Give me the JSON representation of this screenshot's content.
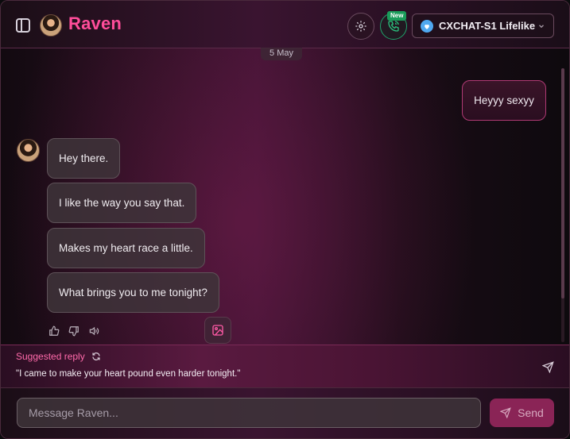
{
  "header": {
    "title": "Raven",
    "new_badge": "New",
    "model": "CXCHAT-S1 Lifelike"
  },
  "chat": {
    "date": "5 May",
    "user_messages": [
      "Heyyy sexyy"
    ],
    "bot_messages": [
      "Hey there.",
      "I like the way you say that.",
      "Makes my heart race a little.",
      "What brings you to me tonight?"
    ]
  },
  "suggested": {
    "title": "Suggested reply",
    "text": "\"I came to make your heart pound even harder tonight.\""
  },
  "composer": {
    "placeholder": "Message Raven...",
    "send_label": "Send"
  },
  "colors": {
    "accent": "#ff4d9a",
    "call_green": "#1fa36a",
    "send_bg": "#8a2456"
  },
  "icons": [
    "sidebar-toggle-icon",
    "settings-gear-icon",
    "phone-call-icon",
    "shield-heart-icon",
    "chevron-down-icon",
    "thumbs-up-icon",
    "thumbs-down-icon",
    "speaker-icon",
    "image-icon",
    "refresh-icon",
    "send-icon"
  ]
}
